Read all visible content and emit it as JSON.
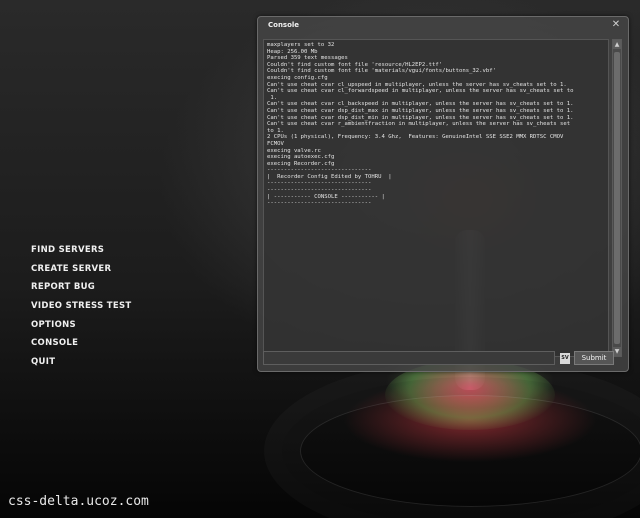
{
  "menu": {
    "items": [
      {
        "label": "FIND SERVERS"
      },
      {
        "label": "CREATE SERVER"
      },
      {
        "label": "REPORT BUG"
      },
      {
        "label": "VIDEO STRESS TEST"
      },
      {
        "label": "OPTIONS"
      },
      {
        "label": "CONSOLE"
      },
      {
        "label": "QUIT"
      }
    ]
  },
  "watermark": "css-delta.ucoz.com",
  "console": {
    "title": "Console",
    "close_glyph": "✕",
    "log_lines": [
      "maxplayers set to 32",
      "Heap: 256.00 Mb",
      "Parsed 359 text messages",
      "Couldn't find custom font file 'resource/HL2EP2.ttf'",
      "Couldn't find custom font file 'materials/vgui/fonts/buttons_32.vbf'",
      "execing config.cfg",
      "Can't use cheat cvar cl_upspeed in multiplayer, unless the server has sv_cheats set to 1.",
      "Can't use cheat cvar cl_forwardspeed in multiplayer, unless the server has sv_cheats set to",
      " 1.",
      "Can't use cheat cvar cl_backspeed in multiplayer, unless the server has sv_cheats set to 1.",
      "Can't use cheat cvar dsp_dist_max in multiplayer, unless the server has sv_cheats set to 1.",
      "Can't use cheat cvar dsp_dist_min in multiplayer, unless the server has sv_cheats set to 1.",
      "Can't use cheat cvar r_ambientfraction in multiplayer, unless the server has sv_cheats set",
      "to 1.",
      "2 CPUs (1 physical), Frequency: 3.4 Ghz,  Features: GenuineIntel SSE SSE2 MMX RDTSC CMOV",
      "FCMOV",
      "execing valve.rc",
      "execing autoexec.cfg",
      "execing Recorder.cfg",
      "-------------------------------",
      "|  Recorder Config Edited by TOHRU  |",
      "-------------------------------",
      "-------------------------------",
      "| ----------- CONSOLE ----------- |",
      "-------------------------------"
    ],
    "input_value": "",
    "sv_badge": "SV",
    "submit_label": "Submit",
    "scroll_up_glyph": "▲",
    "scroll_down_glyph": "▼"
  }
}
